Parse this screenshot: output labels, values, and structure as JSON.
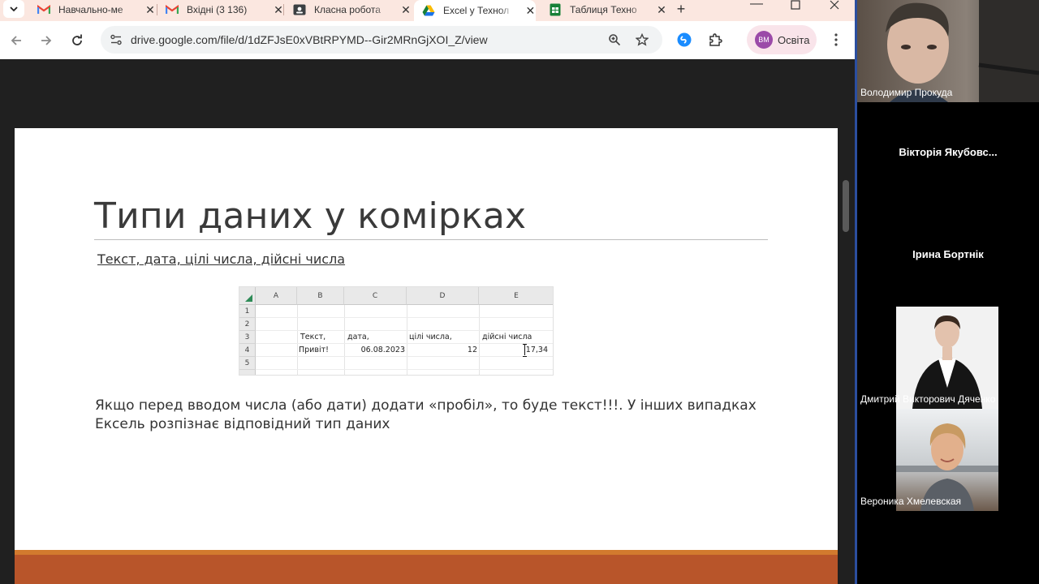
{
  "browser": {
    "tabs": [
      {
        "title": "Навчально-ме",
        "icon": "gmail-icon",
        "active": false
      },
      {
        "title": "Вхідні (3 136)",
        "icon": "gmail-icon",
        "active": false
      },
      {
        "title": "Класна робота",
        "icon": "classroom-icon",
        "active": false
      },
      {
        "title": "Excel у Технол",
        "icon": "drive-icon",
        "active": true
      },
      {
        "title": "Таблиця Техно",
        "icon": "sheets-icon",
        "active": false
      }
    ],
    "url": "drive.google.com/file/d/1dZFJsE0xVBtRPYMD--Gir2MRnGjXOI_Z/view",
    "profile_initials": "ВМ",
    "profile_label": "Освіта",
    "colors": {
      "tabstrip": "#fbe7e0",
      "accent_drive": "#1a73e8",
      "gmail": "#ea4335",
      "sheets": "#188038"
    }
  },
  "slide": {
    "title": "Типи даних у комірках",
    "subtitle": "Текст, дата, цілі числа, дійсні числа",
    "body": "Якщо перед вводом числа (або дати) додати «пробіл», то буде текст!!!. У інших випадках Ексель розпізнає відповідний тип даних",
    "sheet": {
      "columns": [
        "A",
        "B",
        "C",
        "D",
        "E"
      ],
      "rows": [
        "1",
        "2",
        "3",
        "4",
        "5"
      ],
      "row3": {
        "b": "Текст,",
        "c": "дата,",
        "d": "цілі числа,",
        "e": "дійсні числа"
      },
      "row4": {
        "b": "Привіт!",
        "c": "06.08.2023",
        "d": "12",
        "e": "17,34"
      }
    }
  },
  "participants": [
    {
      "name": "Володимир Прокуда",
      "video": true
    },
    {
      "name": "Вікторія Якубовс...",
      "video": false
    },
    {
      "name": "Ірина Бортнік",
      "video": false
    },
    {
      "name": "Дмитрий Викторович Дяченко",
      "video": true
    },
    {
      "name": "Вероника Хмелевская",
      "video": true
    }
  ]
}
